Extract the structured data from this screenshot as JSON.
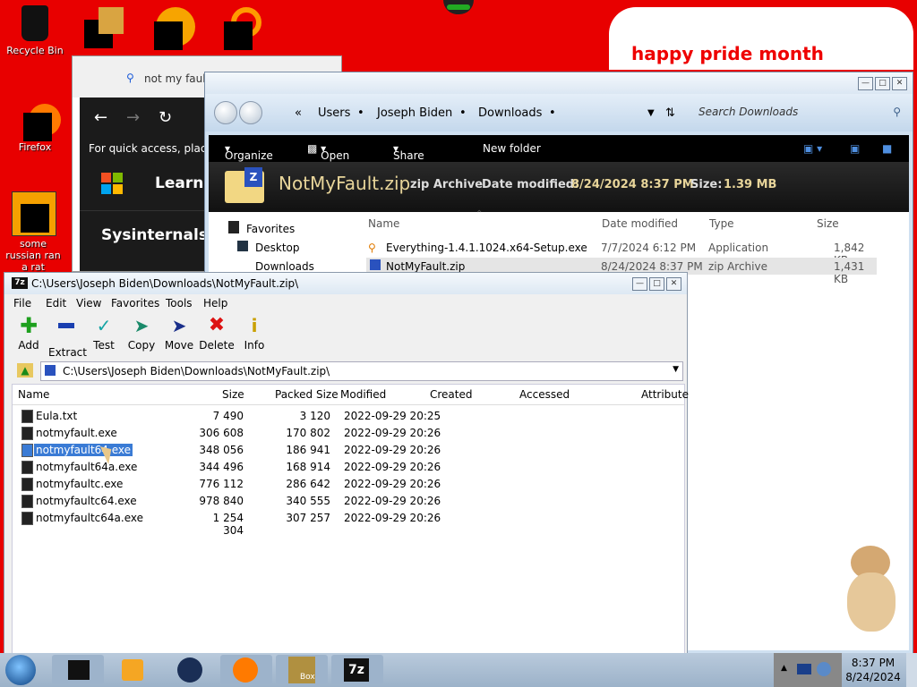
{
  "desktop": {
    "icons": [
      {
        "label": "Recycle Bin"
      },
      {
        "label": "Firefox"
      },
      {
        "label": "some russian ran a rat"
      }
    ],
    "banner": "happy pride month"
  },
  "browser": {
    "search_text": "not my fault",
    "quick_access": "For quick access, place y",
    "learn": "Learn",
    "sysinternals": "Sysinternals"
  },
  "explorer": {
    "breadcrumb": [
      "Users",
      "Joseph Biden",
      "Downloads"
    ],
    "search_placeholder": "Search Downloads",
    "toolbar": {
      "organize": "Organize",
      "open": "Open",
      "share_with": "Share with",
      "new_folder": "New folder"
    },
    "details": {
      "name": "NotMyFault.zip",
      "type": "zip Archive",
      "date_label": "Date modified:",
      "date_value": "8/24/2024 8:37 PM",
      "size_label": "Size:",
      "size_value": "1.39 MB"
    },
    "nav": {
      "favorites": "Favorites",
      "desktop": "Desktop",
      "downloads": "Downloads"
    },
    "columns": {
      "name": "Name",
      "date": "Date modified",
      "type": "Type",
      "size": "Size"
    },
    "files": [
      {
        "name": "Everything-1.4.1.1024.x64-Setup.exe",
        "date": "7/7/2024 6:12 PM",
        "type": "Application",
        "size": "1,842 KB"
      },
      {
        "name": "NotMyFault.zip",
        "date": "8/24/2024 8:37 PM",
        "type": "zip Archive",
        "size": "1,431 KB"
      }
    ]
  },
  "zip": {
    "title": "C:\\Users\\Joseph Biden\\Downloads\\NotMyFault.zip\\",
    "menu": [
      "File",
      "Edit",
      "View",
      "Favorites",
      "Tools",
      "Help"
    ],
    "tools": [
      "Add",
      "Extract",
      "Test",
      "Copy",
      "Move",
      "Delete",
      "Info"
    ],
    "path": "C:\\Users\\Joseph Biden\\Downloads\\NotMyFault.zip\\",
    "columns": {
      "name": "Name",
      "size": "Size",
      "packed": "Packed Size",
      "modified": "Modified",
      "created": "Created",
      "accessed": "Accessed",
      "attributes": "Attribute"
    },
    "rows": [
      {
        "name": "Eula.txt",
        "size": "7 490",
        "packed": "3 120",
        "modified": "2022-09-29 20:25"
      },
      {
        "name": "notmyfault.exe",
        "size": "306 608",
        "packed": "170 802",
        "modified": "2022-09-29 20:26"
      },
      {
        "name": "notmyfault64.exe",
        "size": "348 056",
        "packed": "186 941",
        "modified": "2022-09-29 20:26"
      },
      {
        "name": "notmyfault64a.exe",
        "size": "344 496",
        "packed": "168 914",
        "modified": "2022-09-29 20:26"
      },
      {
        "name": "notmyfaultc.exe",
        "size": "776 112",
        "packed": "286 642",
        "modified": "2022-09-29 20:26"
      },
      {
        "name": "notmyfaultc64.exe",
        "size": "978 840",
        "packed": "340 555",
        "modified": "2022-09-29 20:26"
      },
      {
        "name": "notmyfaultc64a.exe",
        "size": "1 254 304",
        "packed": "307 257",
        "modified": "2022-09-29 20:26"
      }
    ]
  },
  "taskbar": {
    "time": "8:37 PM",
    "date": "8/24/2024",
    "box_label": "Box"
  }
}
